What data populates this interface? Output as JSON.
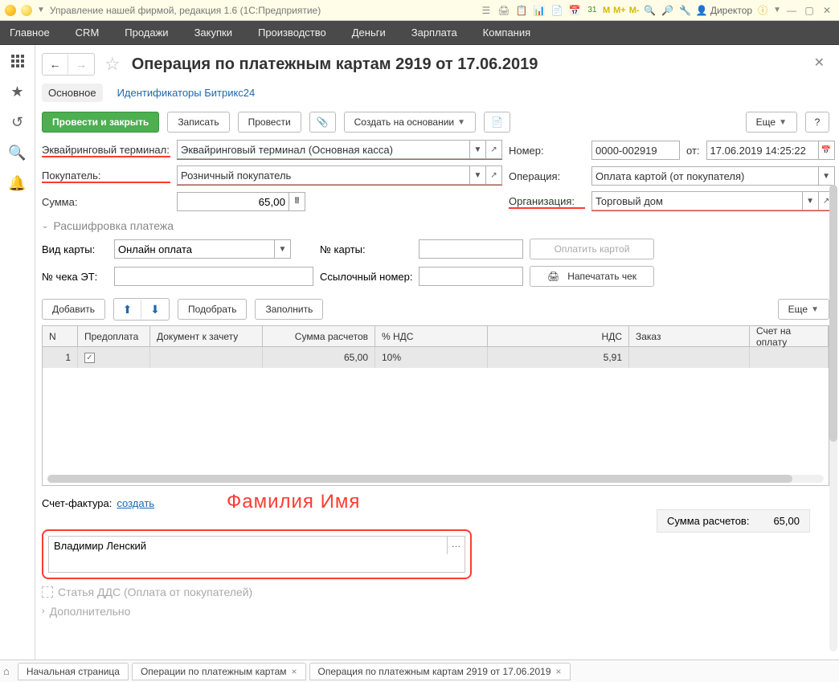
{
  "titlebar": {
    "title": "Управление нашей фирмой, редакция 1.6  (1С:Предприятие)",
    "memory": [
      "M",
      "M+",
      "M-"
    ],
    "user_label": "Директор"
  },
  "nav": [
    "Главное",
    "CRM",
    "Продажи",
    "Закупки",
    "Производство",
    "Деньги",
    "Зарплата",
    "Компания"
  ],
  "header": {
    "title": "Операция по платежным картам 2919 от 17.06.2019"
  },
  "subtabs": {
    "main": "Основное",
    "bitrix": "Идентификаторы Битрикс24"
  },
  "cmd": {
    "post_close": "Провести и закрыть",
    "save": "Записать",
    "post": "Провести",
    "create_based": "Создать на основании",
    "more": "Еще",
    "help": "?"
  },
  "fields": {
    "terminal_label": "Эквайринговый терминал:",
    "terminal_value": "Эквайринговый терминал  (Основная касса)",
    "number_label": "Номер:",
    "number_value": "0000-002919",
    "date_prefix": "от:",
    "date_value": "17.06.2019 14:25:22",
    "buyer_label": "Покупатель:",
    "buyer_value": "Розничный покупатель",
    "operation_label": "Операция:",
    "operation_value": "Оплата картой (от покупателя)",
    "amount_label": "Сумма:",
    "amount_value": "65,00",
    "org_label": "Организация:",
    "org_value": "Торговый дом"
  },
  "section": {
    "title": "Расшифровка платежа",
    "card_type_label": "Вид карты:",
    "card_type_value": "Онлайн оплата",
    "card_no_label": "№ карты:",
    "card_no_value": "",
    "pay_btn": "Оплатить картой",
    "check_label": "№ чека ЭТ:",
    "check_value": "",
    "ref_label": "Ссылочный номер:",
    "ref_value": "",
    "print_btn": "Напечатать чек"
  },
  "table_cmd": {
    "add": "Добавить",
    "pick": "Подобрать",
    "fill": "Заполнить",
    "more": "Еще"
  },
  "table": {
    "headers": {
      "n": "N",
      "prepay": "Предоплата",
      "doc": "Документ к зачету",
      "sum": "Сумма расчетов",
      "vat_pct": "% НДС",
      "vat": "НДС",
      "order": "Заказ",
      "invoice": "Счет на оплату"
    },
    "rows": [
      {
        "n": "1",
        "prepay": true,
        "doc": "",
        "sum": "65,00",
        "vat_pct": "10%",
        "vat": "5,91",
        "order": "",
        "invoice": ""
      }
    ]
  },
  "sf": {
    "label": "Счет-фактура:",
    "create": "создать",
    "annotation": "Фамилия Имя"
  },
  "totals": {
    "label": "Сумма расчетов:",
    "value": "65,00"
  },
  "comment": {
    "value": "Владимир Ленский"
  },
  "ghost": {
    "dds": "Статья ДДС (Оплата от покупателей)",
    "more": "Дополнительно"
  },
  "tabs": {
    "home": "Начальная страница",
    "list": "Операции по платежным картам",
    "doc": "Операция по платежным картам 2919 от 17.06.2019"
  }
}
